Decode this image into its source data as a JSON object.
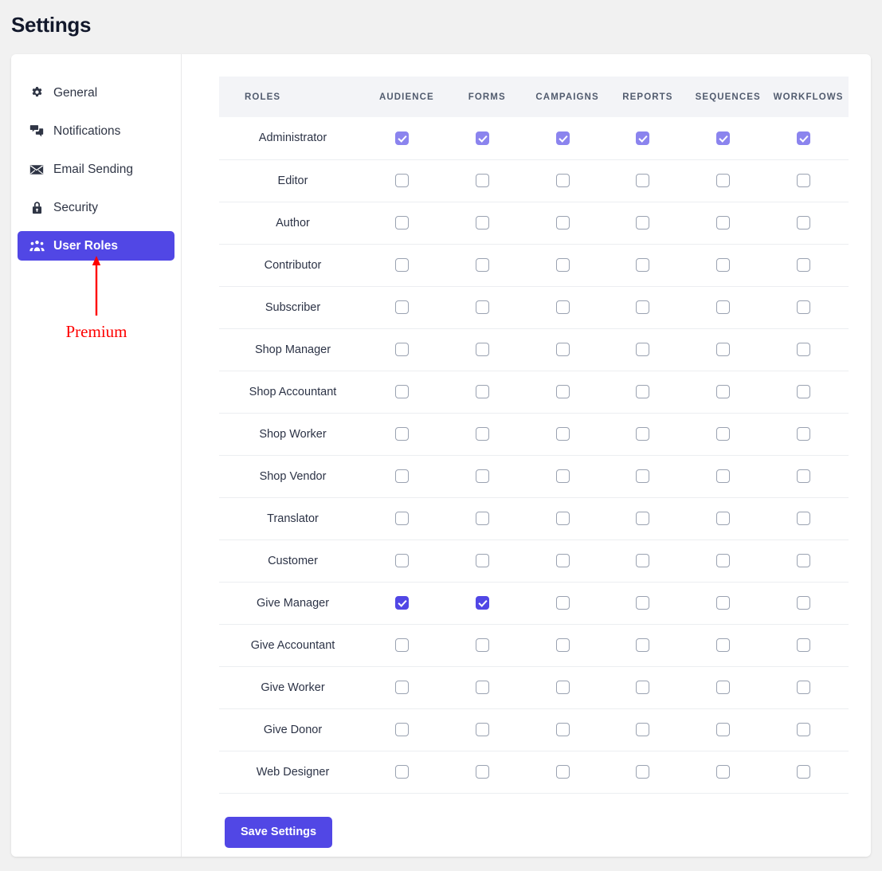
{
  "page": {
    "title": "Settings"
  },
  "sidebar": {
    "items": [
      {
        "label": "General",
        "icon": "gear-icon",
        "active": false
      },
      {
        "label": "Notifications",
        "icon": "speech-bubbles-icon",
        "active": false
      },
      {
        "label": "Email Sending",
        "icon": "envelope-icon",
        "active": false
      },
      {
        "label": "Security",
        "icon": "lock-icon",
        "active": false
      },
      {
        "label": "User Roles",
        "icon": "users-group-icon",
        "active": true
      }
    ],
    "annotation": {
      "label": "Premium",
      "icon": "up-arrow-icon",
      "color": "#fe0000"
    }
  },
  "table": {
    "columns": [
      "ROLES",
      "AUDIENCE",
      "FORMS",
      "CAMPAIGNS",
      "REPORTS",
      "SEQUENCES",
      "WORKFLOWS"
    ],
    "rows": [
      {
        "role": "Administrator",
        "values": [
          true,
          true,
          true,
          true,
          true,
          true
        ],
        "disabled": true
      },
      {
        "role": "Editor",
        "values": [
          false,
          false,
          false,
          false,
          false,
          false
        ],
        "disabled": false
      },
      {
        "role": "Author",
        "values": [
          false,
          false,
          false,
          false,
          false,
          false
        ],
        "disabled": false
      },
      {
        "role": "Contributor",
        "values": [
          false,
          false,
          false,
          false,
          false,
          false
        ],
        "disabled": false
      },
      {
        "role": "Subscriber",
        "values": [
          false,
          false,
          false,
          false,
          false,
          false
        ],
        "disabled": false
      },
      {
        "role": "Shop Manager",
        "values": [
          false,
          false,
          false,
          false,
          false,
          false
        ],
        "disabled": false
      },
      {
        "role": "Shop Accountant",
        "values": [
          false,
          false,
          false,
          false,
          false,
          false
        ],
        "disabled": false
      },
      {
        "role": "Shop Worker",
        "values": [
          false,
          false,
          false,
          false,
          false,
          false
        ],
        "disabled": false
      },
      {
        "role": "Shop Vendor",
        "values": [
          false,
          false,
          false,
          false,
          false,
          false
        ],
        "disabled": false
      },
      {
        "role": "Translator",
        "values": [
          false,
          false,
          false,
          false,
          false,
          false
        ],
        "disabled": false
      },
      {
        "role": "Customer",
        "values": [
          false,
          false,
          false,
          false,
          false,
          false
        ],
        "disabled": false
      },
      {
        "role": "Give Manager",
        "values": [
          true,
          true,
          false,
          false,
          false,
          false
        ],
        "disabled": false
      },
      {
        "role": "Give Accountant",
        "values": [
          false,
          false,
          false,
          false,
          false,
          false
        ],
        "disabled": false
      },
      {
        "role": "Give Worker",
        "values": [
          false,
          false,
          false,
          false,
          false,
          false
        ],
        "disabled": false
      },
      {
        "role": "Give Donor",
        "values": [
          false,
          false,
          false,
          false,
          false,
          false
        ],
        "disabled": false
      },
      {
        "role": "Web Designer",
        "values": [
          false,
          false,
          false,
          false,
          false,
          false
        ],
        "disabled": false
      }
    ]
  },
  "actions": {
    "save_label": "Save Settings"
  },
  "colors": {
    "accent": "#5147e5",
    "accent_muted": "#8b84ee",
    "page_background": "#f1f1f1",
    "header_background": "#f3f4f7",
    "annotation": "#fe0000"
  }
}
